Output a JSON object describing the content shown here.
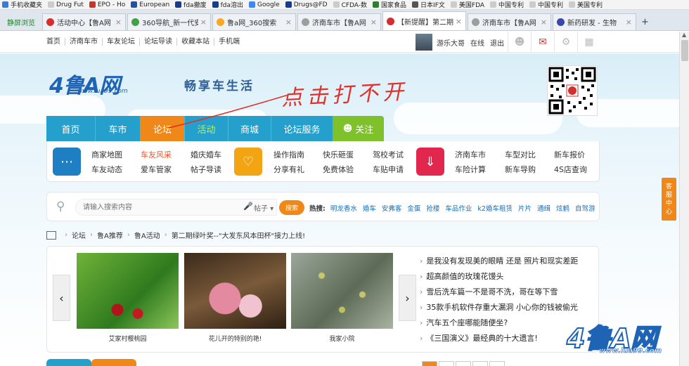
{
  "bookmarks": [
    {
      "label": "手机收藏夹",
      "color": "#3a7bd5"
    },
    {
      "label": "Drug Fut",
      "color": "#cccccc"
    },
    {
      "label": "EPO - Ho",
      "color": "#c0392b"
    },
    {
      "label": "European",
      "color": "#2a4fa0"
    },
    {
      "label": "fda撤废",
      "color": "#1a3a8a"
    },
    {
      "label": "fda溶出",
      "color": "#1a3a8a"
    },
    {
      "label": "Google",
      "color": "#4285f4"
    },
    {
      "label": "Drugs@FD",
      "color": "#1a3a8a"
    },
    {
      "label": "CFDA-数",
      "color": "#cccccc"
    },
    {
      "label": "国家食品",
      "color": "#2e7d32"
    },
    {
      "label": "日本IF文",
      "color": "#555555"
    },
    {
      "label": "美国FDA",
      "color": "#cccccc"
    },
    {
      "label": "中国专利",
      "color": "#cccccc"
    },
    {
      "label": "中国专利",
      "color": "#cccccc"
    },
    {
      "label": "美国专利",
      "color": "#cccccc"
    }
  ],
  "browser": {
    "home_label": "静屏浏览",
    "tabs": [
      {
        "label": "活动中心【鲁A网",
        "icon_color": "#d32f2f",
        "active": false
      },
      {
        "label": "360导航_新一代安",
        "icon_color": "#43a047",
        "active": false
      },
      {
        "label": "鲁a网_360搜索",
        "icon_color": "#f9a825",
        "active": false
      },
      {
        "label": "济南车市【鲁A网",
        "icon_color": "#9e9e9e",
        "active": false
      },
      {
        "label": "【新提醒】第二期",
        "icon_color": "#d32f2f",
        "active": true
      },
      {
        "label": "济南车市【鲁A网",
        "icon_color": "#9e9e9e",
        "active": false
      },
      {
        "label": "新药研发 - 生物",
        "icon_color": "#3949ab",
        "active": false
      }
    ],
    "new_tab": "+",
    "close_symbol": "×"
  },
  "topnav": {
    "links": [
      "首页",
      "济南车市",
      "车友论坛",
      "论坛导读",
      "收藏本站",
      "手机端"
    ],
    "username": "游乐大哥",
    "online": "在线",
    "logout": "退出"
  },
  "header": {
    "logo": "4鲁A网",
    "logo_url": "www.lua99.com",
    "slogan": "畅享车生活",
    "handwriting": "点击打不开"
  },
  "mainnav": [
    "首页",
    "车市",
    "论坛",
    "活动",
    "商城",
    "论坛服务",
    "关注"
  ],
  "subnav": {
    "group1": [
      "商家地图",
      "车友风采",
      "婚庆婚车",
      "车友动态",
      "爱车管家",
      "帖子导读"
    ],
    "group2": [
      "操作指南",
      "快乐砸蛋",
      "驾校考试",
      "分享有礼",
      "免费体验",
      "车贴申请"
    ],
    "group3": [
      "济南车市",
      "车型对比",
      "新车报价",
      "车险计算",
      "新车导购",
      "4S店查询"
    ]
  },
  "search": {
    "placeholder": "请输入搜索内容",
    "type": "帖子",
    "button": "搜索",
    "hot_label": "热搜:",
    "hot_terms": [
      "明龙香水",
      "婚车",
      "安弗客",
      "金蛋",
      "抢楼",
      "车品作业",
      "k2婚车租赁",
      "片片",
      "通缉",
      "炫鹤",
      "自驾游"
    ]
  },
  "breadcrumb": [
    "论坛",
    "鲁A推荐",
    "鲁A活动",
    "第二期绿叶奖--\"大发东风本田杯\"接力上线!"
  ],
  "gallery": {
    "prev": "‹",
    "next": "›",
    "captions": [
      "艾家村樱桃园",
      "花儿开的特别的艳!",
      "我家小院"
    ]
  },
  "news": [
    "是我没有发现美的眼睛 还是 照片和现实差距",
    "超高颜值的玫瑰花馒头",
    "雪后洗车篇一不是哥不洗，哥在等下雪",
    "35款手机软件存重大漏洞 小心你的钱被偷光",
    "汽车五个座哪能随便坐?",
    "《三国演义》最经典的十大遗言!"
  ],
  "side_service": [
    "客",
    "服",
    "中",
    "心"
  ],
  "watermark": {
    "logo": "4鲁A网",
    "url": "www.lua99.com"
  }
}
